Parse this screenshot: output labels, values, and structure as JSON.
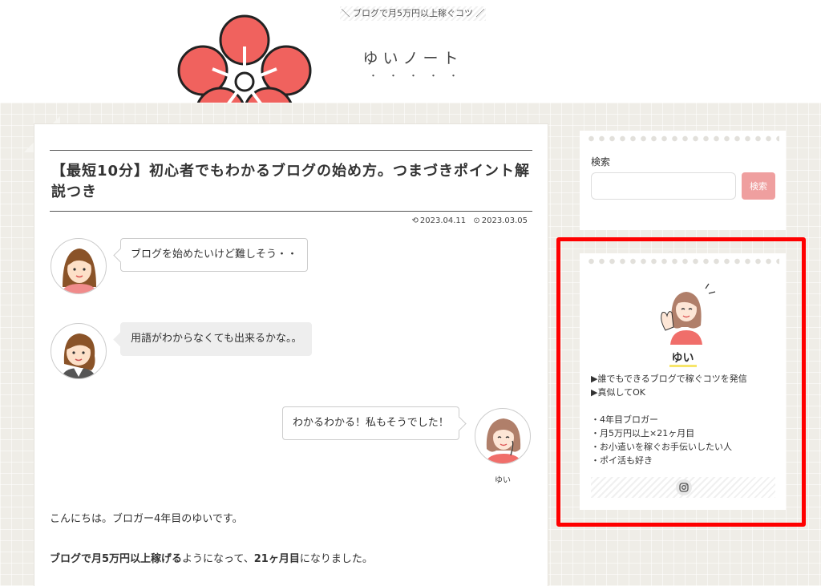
{
  "header": {
    "tagline": "＼ ブログで月5万円以上稼ぐコツ ／",
    "site_title": "ゆいノート",
    "site_dots": "・・・・・"
  },
  "article": {
    "title": "【最短10分】初心者でもわかるブログの始め方。つまづきポイント解説つき",
    "updated": "2023.04.11",
    "published": "2023.03.05",
    "chat": [
      {
        "text": "ブログを始めたいけど難しそう・・"
      },
      {
        "text": "用語がわからなくても出来るかな。。"
      },
      {
        "text": "わかるわかる！私もそうでした！",
        "name": "ゆい"
      }
    ],
    "para1": "こんにちは。ブロガー4年目のゆいです。",
    "para2": {
      "bold1": "ブログで月5万円以上稼げる",
      "mid": "ようになって、",
      "bold2": "21ヶ月目",
      "end": "になりました。"
    }
  },
  "search": {
    "label": "検索",
    "placeholder": "",
    "button": "検索"
  },
  "profile": {
    "name": "ゆい",
    "lines": [
      "▶誰でもできるブログで稼ぐコツを発信",
      "▶真似してOK",
      "",
      "・4年目ブロガー",
      "・月5万円以上×21ヶ月目",
      "・お小遣いを稼ぐお手伝いしたい人",
      "・ポイ活も好き"
    ],
    "social_icon": "instagram-icon"
  },
  "colors": {
    "accent_pink": "#ef9f9f",
    "flower_red": "#f0625e",
    "highlight": "#ff0000"
  }
}
